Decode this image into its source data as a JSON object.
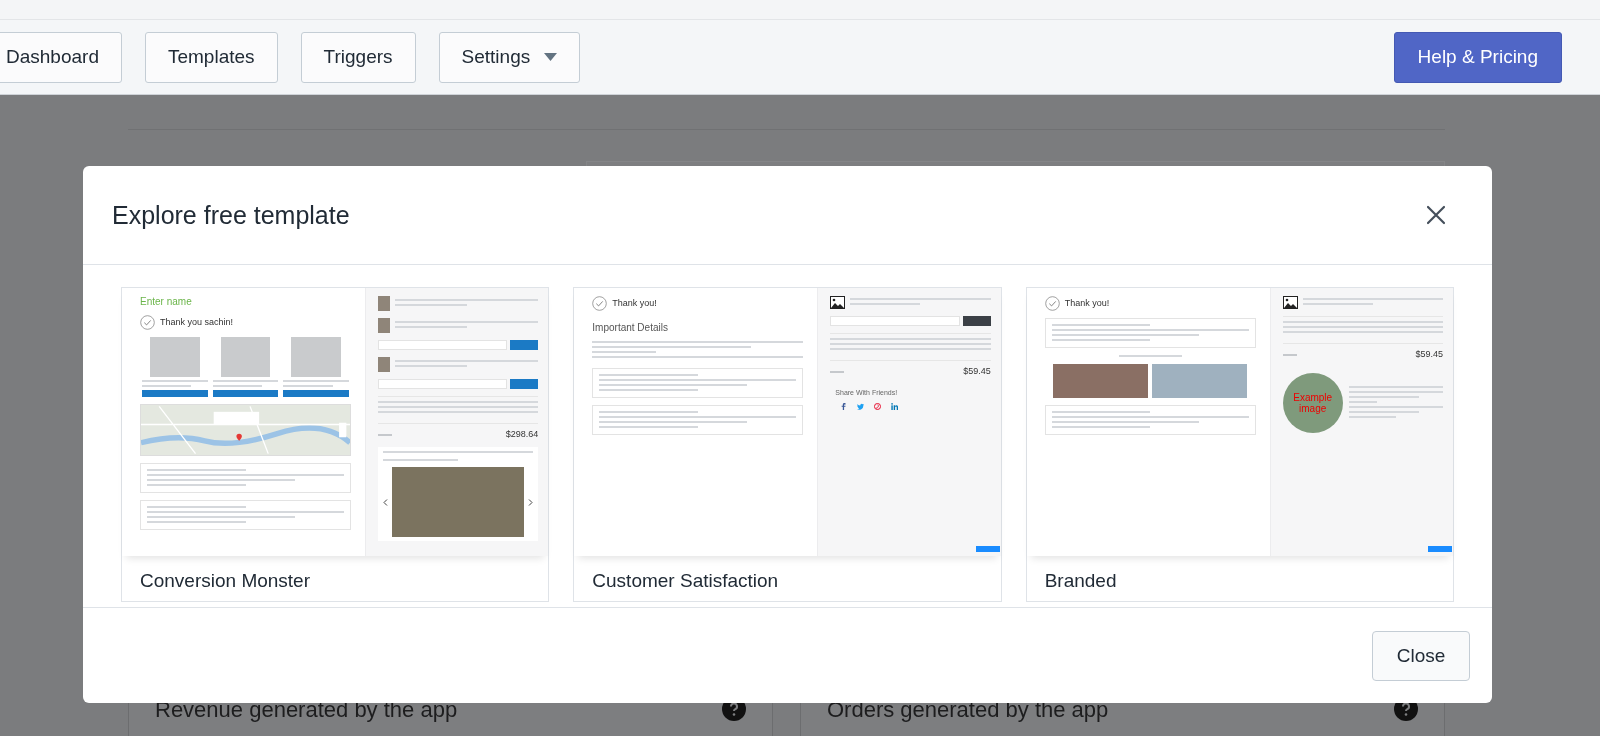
{
  "nav": {
    "buttons": [
      {
        "label": "Dashboard",
        "menu": false
      },
      {
        "label": "Templates",
        "menu": false
      },
      {
        "label": "Triggers",
        "menu": false
      },
      {
        "label": "Settings",
        "menu": true
      }
    ],
    "help_button": "Help & Pricing"
  },
  "background": {
    "cards": [
      {
        "title": "Revenue generated by the app"
      },
      {
        "title": "Orders generated by the app"
      }
    ]
  },
  "modal": {
    "title": "Explore free template",
    "close_button": "Close",
    "templates": [
      {
        "name": "Conversion Monster",
        "left": [
          {
            "kind": "name",
            "text": "Enter name"
          },
          {
            "kind": "check",
            "thanks": "Thank you sachin!"
          },
          {
            "kind": "products"
          },
          {
            "kind": "map"
          },
          {
            "kind": "card"
          },
          {
            "kind": "card"
          }
        ],
        "right": [
          {
            "kind": "photo_item"
          },
          {
            "kind": "photo_item"
          },
          {
            "kind": "comment_primary"
          },
          {
            "kind": "photo_item"
          },
          {
            "kind": "comment_primary"
          },
          {
            "kind": "rows"
          },
          {
            "kind": "total",
            "amount": "$298.64"
          },
          {
            "kind": "photo_card"
          }
        ]
      },
      {
        "name": "Customer Satisfaction",
        "left": [
          {
            "kind": "check",
            "thanks": "Thank you!"
          },
          {
            "kind": "heading",
            "text": "Important Details"
          },
          {
            "kind": "text_lines"
          },
          {
            "kind": "card"
          },
          {
            "kind": "card"
          }
        ],
        "right": [
          {
            "kind": "placeholder_item"
          },
          {
            "kind": "comment_dark"
          },
          {
            "kind": "rows"
          },
          {
            "kind": "total",
            "amount": "$59.45"
          },
          {
            "kind": "share",
            "title": "Share With Friends!"
          },
          {
            "kind": "chat"
          }
        ]
      },
      {
        "name": "Branded",
        "left": [
          {
            "kind": "check",
            "thanks": "Thank you!"
          },
          {
            "kind": "card"
          },
          {
            "kind": "collection"
          },
          {
            "kind": "card"
          }
        ],
        "right": [
          {
            "kind": "placeholder_item"
          },
          {
            "kind": "rows"
          },
          {
            "kind": "total",
            "amount": "$59.45"
          },
          {
            "kind": "about",
            "image_text": "Example image"
          },
          {
            "kind": "chat"
          }
        ]
      }
    ]
  }
}
